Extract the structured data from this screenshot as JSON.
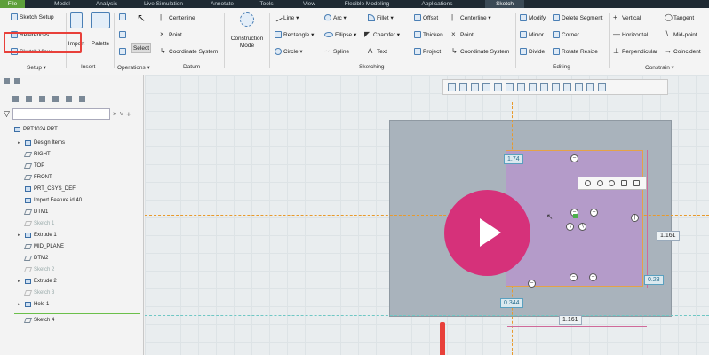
{
  "tabs": [
    "File",
    "Model",
    "Analysis",
    "Live Simulation",
    "Annotate",
    "Tools",
    "View",
    "Flexible Modeling",
    "Applications",
    "Sketch"
  ],
  "ribbon": {
    "setup": {
      "sketch_setup": "Sketch Setup",
      "references": "References",
      "sketch_view": "Sketch View",
      "label": "Setup ▾"
    },
    "insert": {
      "import": "Import",
      "palette": "Palette",
      "label": "Insert"
    },
    "operations": {
      "select": "Select",
      "label": "Operations ▾"
    },
    "datum": {
      "centerline": "Centerline",
      "point": "Point",
      "coordinate_system": "Coordinate System",
      "label": "Datum"
    },
    "construction_mode": "Construction Mode",
    "sketching": {
      "line": "Line ▾",
      "rectangle": "Rectangle ▾",
      "circle": "Circle ▾",
      "arc": "Arc ▾",
      "ellipse": "Ellipse ▾",
      "spline": "Spline",
      "fillet": "Fillet ▾",
      "chamfer": "Chamfer ▾",
      "text": "Text",
      "offset": "Offset",
      "thicken": "Thicken",
      "project": "Project",
      "centerline": "Centerline ▾",
      "point": "Point",
      "coordinate_system": "Coordinate System",
      "label": "Sketching"
    },
    "editing": {
      "modify": "Modify",
      "delete_segment": "Delete Segment",
      "mirror": "Mirror",
      "corner": "Corner",
      "divide": "Divide",
      "rotate_resize": "Rotate Resize",
      "label": "Editing"
    },
    "constrain": {
      "vertical": "Vertical",
      "tangent": "Tangent",
      "horizontal": "Horizontal",
      "mid_point": "Mid-point",
      "perpendicular": "Perpendicular",
      "coincident": "Coincident",
      "label": "Constrain ▾"
    }
  },
  "tree": [
    {
      "label": "PRT1024.PRT",
      "dim": false
    },
    {
      "label": "Design Items",
      "dim": false
    },
    {
      "label": "RIGHT",
      "dim": false
    },
    {
      "label": "TOP",
      "dim": false
    },
    {
      "label": "FRONT",
      "dim": false
    },
    {
      "label": "PRT_CSYS_DEF",
      "dim": false
    },
    {
      "label": "Import Feature id 40",
      "dim": false
    },
    {
      "label": "DTM1",
      "dim": false
    },
    {
      "label": "Sketch 1",
      "dim": true
    },
    {
      "label": "Extrude 1",
      "dim": false
    },
    {
      "label": "MID_PLANE",
      "dim": false
    },
    {
      "label": "DTM2",
      "dim": false
    },
    {
      "label": "Sketch 2",
      "dim": true
    },
    {
      "label": "Extrude 2",
      "dim": false
    },
    {
      "label": "Sketch 3",
      "dim": true
    },
    {
      "label": "Hole 1",
      "dim": false
    },
    {
      "label": "Sketch 4",
      "dim": false
    }
  ],
  "dimensions": {
    "top": "1.74",
    "right": "1.161",
    "bottom": "1.161",
    "left_bottom": "0.344",
    "right_small": "0.23"
  },
  "colors": {
    "play_button": "#d6317a",
    "highlight_red": "#e8403a",
    "sketch_fill": "#b49bc9",
    "plate_fill": "#a9b3bc"
  }
}
